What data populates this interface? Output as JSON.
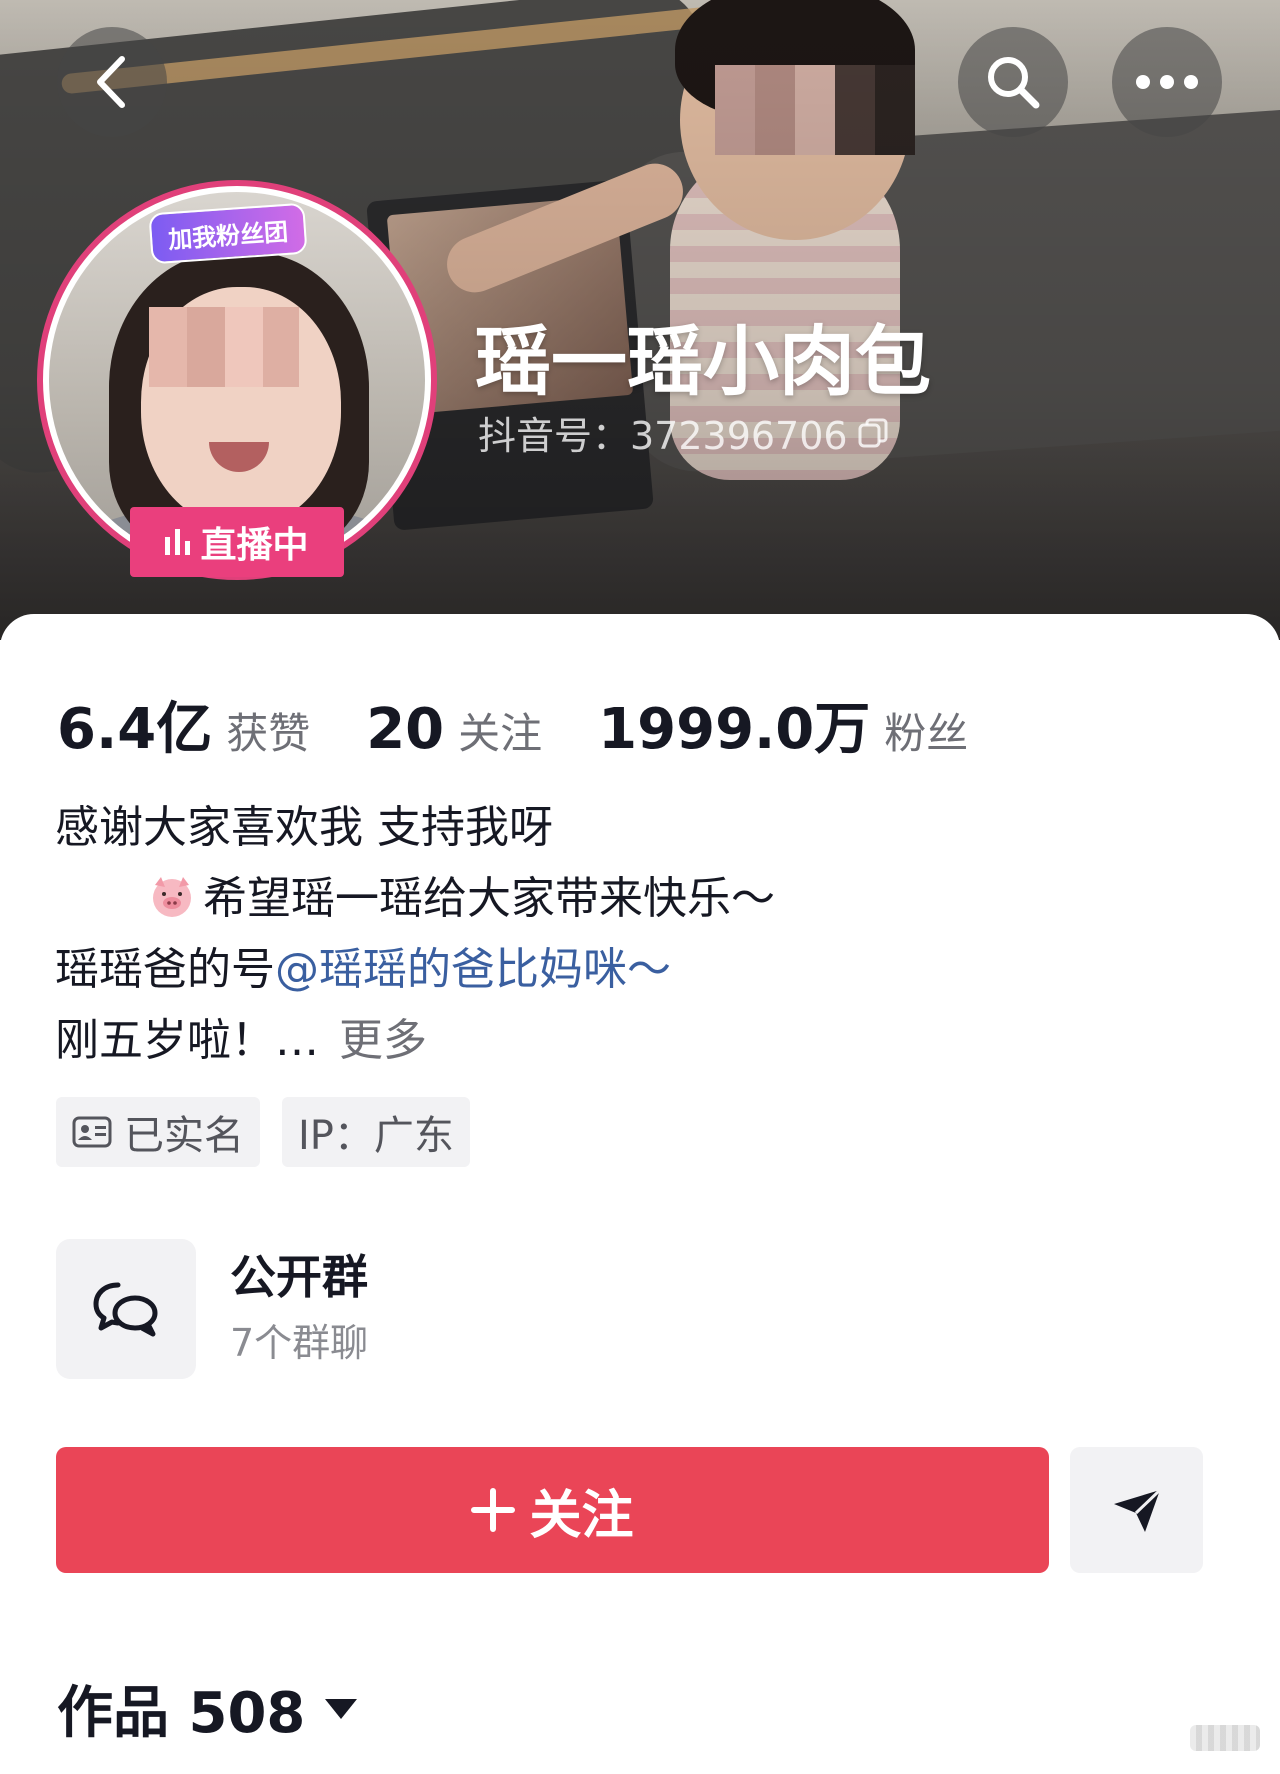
{
  "header": {
    "back_icon": "chevron-left-icon",
    "search_icon": "search-icon",
    "more_icon": "ellipsis-icon"
  },
  "profile": {
    "fan_badge": "加我粉丝团",
    "live_badge": "直播中",
    "nickname": "瑶一瑶小肉包",
    "douyin_id": "抖音号：372396706",
    "copy_icon": "copy-icon"
  },
  "stats": [
    {
      "value": "6.4亿",
      "label": "获赞"
    },
    {
      "value": "20",
      "label": "关注"
    },
    {
      "value": "1999.0万",
      "label": "粉丝"
    }
  ],
  "bio": {
    "line1": "感谢大家喜欢我 支持我呀",
    "line2_emoji": "pig-face-icon",
    "line2": "希望瑶一瑶给大家带来快乐～",
    "line3_prefix": "瑶瑶爸的号",
    "line3_mention": "@瑶瑶的爸比妈咪～",
    "line4": " 刚五岁啦！…",
    "more": "更多"
  },
  "tags": [
    {
      "icon": "id-card-icon",
      "label": "已实名"
    },
    {
      "label": "IP：广东"
    }
  ],
  "group": {
    "icon": "chat-bubbles-icon",
    "title": "公开群",
    "subtitle": "7个群聊"
  },
  "actions": {
    "follow_label": "关注",
    "follow_icon": "plus-icon",
    "share_icon": "send-icon"
  },
  "works": {
    "label": "作品 508",
    "dropdown_icon": "caret-down-icon"
  },
  "colors": {
    "accent": "#ea4557",
    "live": "#ea3f7d",
    "mention": "#3a5fa0"
  }
}
